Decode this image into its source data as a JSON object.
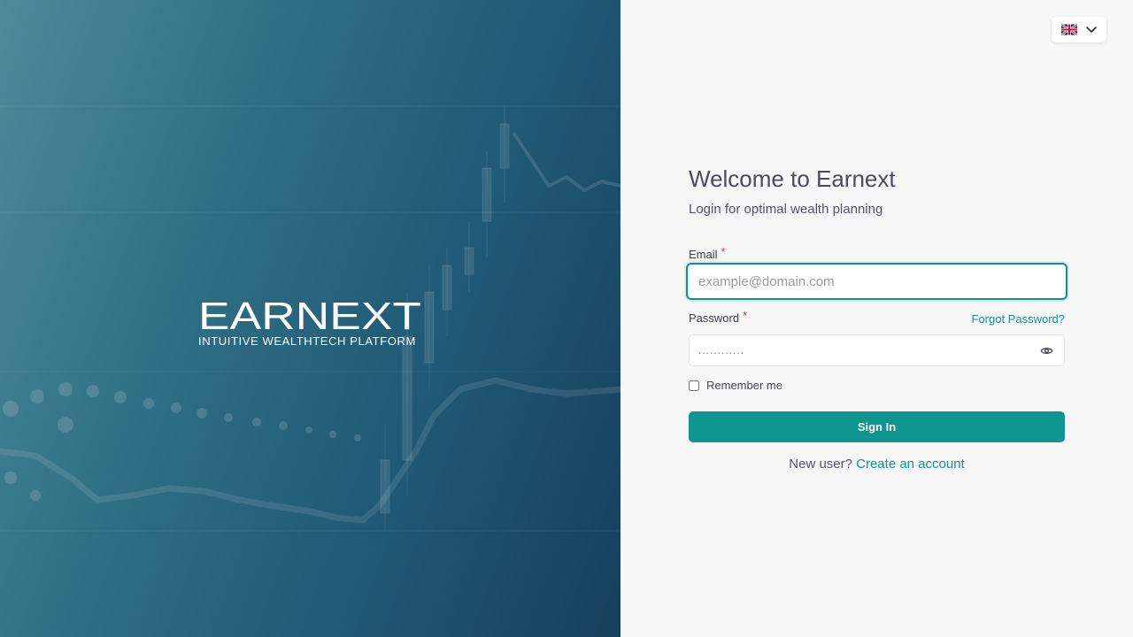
{
  "brand": {
    "name": "EARNEXT",
    "tagline": "INTUITIVE WEALTHTECH PLATFORM"
  },
  "language": {
    "flag_icon": "uk-flag-icon",
    "dropdown_icon": "chevron-down-icon"
  },
  "login": {
    "title": "Welcome to Earnext",
    "subtitle": "Login for optimal wealth planning",
    "email_label": "Email",
    "email_placeholder": "example@domain.com",
    "password_label": "Password",
    "password_value": "............",
    "forgot_password": "Forgot Password?",
    "remember_me": "Remember me",
    "sign_in": "Sign In",
    "new_user_text": "New user?",
    "create_account": "Create an account",
    "required_marker": "*"
  },
  "colors": {
    "accent": "#0e9590",
    "hero_dark": "#173f5c",
    "hero_light": "#4d8a9a"
  }
}
